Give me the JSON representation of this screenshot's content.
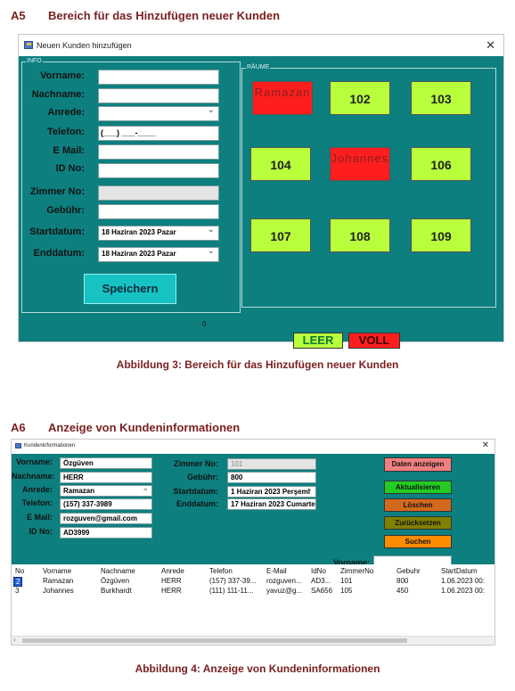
{
  "section_a5": {
    "number": "A5",
    "title": "Bereich für das Hinzufügen neuer Kunden"
  },
  "window1": {
    "title": "Neuen Kunden hinzufügen",
    "group_info": "INFO",
    "group_rooms": "RÄUME",
    "labels": {
      "vorname": "Vorname:",
      "nachname": "Nachname:",
      "anrede": "Anrede:",
      "telefon": "Telefon:",
      "email": "E Mail:",
      "idno": "ID No:",
      "zimmerno": "Zimmer No:",
      "gebuehr": "Gebühr:",
      "startdatum": "Startdatum:",
      "enddatum": "Enddatum:"
    },
    "telefon_mask": "(___) ___-____",
    "startdatum_value": "18 Haziran 2023    Pazar",
    "enddatum_value": "18 Haziran 2023    Pazar",
    "save_label": "Speichern",
    "counter": "0",
    "rooms": [
      {
        "label": "Ramazan",
        "status": "busy"
      },
      {
        "label": "102",
        "status": "free"
      },
      {
        "label": "103",
        "status": "free"
      },
      {
        "label": "104",
        "status": "free"
      },
      {
        "label": "Johannes",
        "status": "busy"
      },
      {
        "label": "106",
        "status": "free"
      },
      {
        "label": "107",
        "status": "free"
      },
      {
        "label": "108",
        "status": "free"
      },
      {
        "label": "109",
        "status": "free"
      }
    ],
    "legend_free": "LEER",
    "legend_busy": "VOLL",
    "colors": {
      "background": "#0d7f7f",
      "free": "#b9ff3c",
      "busy": "#ff1e1e",
      "save": "#16c2c2"
    }
  },
  "caption3": "Abbildung 3: Bereich für das Hinzufügen neuer Kunden",
  "section_a6": {
    "number": "A6",
    "title": "Anzeige von Kundeninformationen"
  },
  "window2": {
    "title": "Kundeninformationen",
    "labels": {
      "vorname": "Vorname:",
      "nachname": "Nachname:",
      "anrede": "Anrede:",
      "telefon": "Telefon:",
      "email": "E Mail:",
      "idno": "ID No:",
      "zimmerno": "Zimmer No:",
      "gebuehr": "Gebühr:",
      "startdatum": "Startdatum:",
      "enddatum": "Enddatum:",
      "vorname_search": "Vorname:"
    },
    "values": {
      "vorname": "Özgüven",
      "nachname": "HERR",
      "anrede": "Ramazan",
      "telefon": "(157) 337-3989",
      "email": "rozguven@gmail.com",
      "idno": "AD3999",
      "zimmerno": "101",
      "gebuehr": "800",
      "startdatum": "1 Haziran  2023 Perşeml",
      "enddatum": "17 Haziran  2023 Cumarte"
    },
    "buttons": {
      "anzeigen": "Daten anzeigen",
      "aktualisieren": "Aktualisieren",
      "loeschen": "Löschen",
      "zuruecksetzen": "Zurücksetzen",
      "suchen": "Suchen"
    },
    "button_colors": {
      "anzeigen": "#f08080",
      "aktualisieren": "#22cc22",
      "loeschen": "#d2691e",
      "zuruecksetzen": "#808000",
      "suchen": "#ff8c00"
    },
    "table": {
      "headers": [
        "No",
        "Vorname",
        "Nachname",
        "Anrede",
        "Telefon",
        "E-Mail",
        "IdNo",
        "ZimmerNo",
        "Gebuhr",
        "StartDatum"
      ],
      "rows": [
        [
          "2",
          "Ramazan",
          "Özgüven",
          "HERR",
          "(157) 337-39...",
          "rozguven...",
          "AD3...",
          "101",
          "800",
          "1.06.2023 00:"
        ],
        [
          "3",
          "Johannes",
          "Burkhardt",
          "HERR",
          "(111) 111-11...",
          "yavuz@g...",
          "SA656",
          "105",
          "450",
          "1.06.2023 00:"
        ]
      ]
    }
  },
  "caption4": "Abbildung 4: Anzeige von Kundeninformationen"
}
